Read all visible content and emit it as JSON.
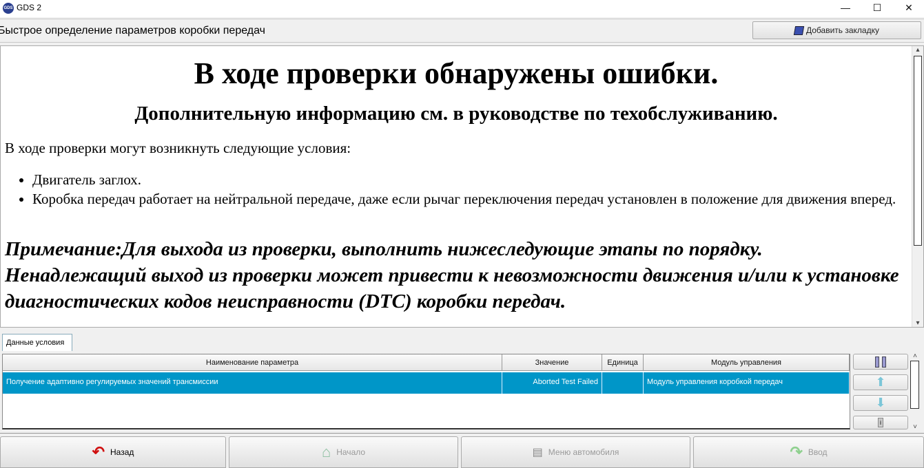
{
  "window": {
    "title": "GDS 2",
    "icon_text": "GDS"
  },
  "header": {
    "title": "Быстрое определение параметров коробки передач",
    "bookmark_label": "Добавить закладку"
  },
  "content": {
    "heading": "В ходе проверки обнаружены ошибки.",
    "subheading": "Дополнительную информацию см. в руководстве по техобслуживанию.",
    "intro": "В ходе проверки могут возникнуть следующие условия:",
    "conditions": [
      "Двигатель заглох.",
      "Коробка передач работает на нейтральной передаче, даже если рычаг переключения передач установлен в положение для движения вперед."
    ],
    "note": "Примечание:Для выхода из проверки, выполнить нижеследующие этапы по порядку. Ненадлежащий выход из проверки может привести к невозможности движения и/или к установке диагностических кодов неисправности (DTC) коробки передач."
  },
  "tab": {
    "label": "Данные условия"
  },
  "table": {
    "columns": [
      "Наименование параметра",
      "Значение",
      "Единица",
      "Модуль управления"
    ],
    "rows": [
      {
        "name": "Получение адаптивно регулируемых значений трансмиссии",
        "value": "Aborted Test Failed",
        "unit": "",
        "module": "Модуль управления коробкой передач"
      }
    ]
  },
  "nav": {
    "back": "Назад",
    "home": "Начало",
    "vehicle_menu": "Меню автомобиля",
    "enter": "Ввод"
  },
  "colors": {
    "selected_row": "#0096c8"
  }
}
